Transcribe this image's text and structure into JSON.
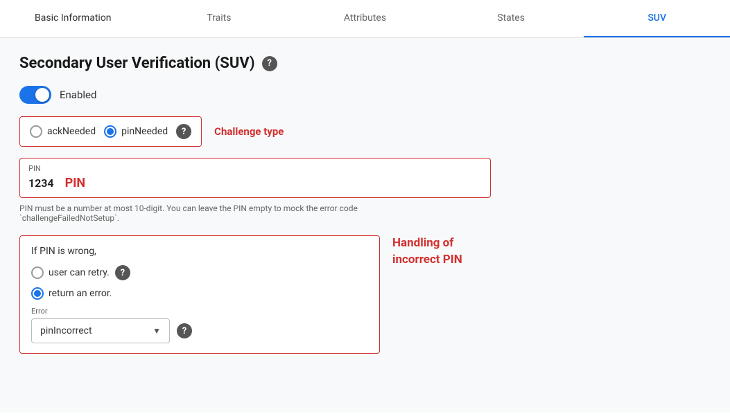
{
  "tabs": [
    {
      "id": "basic-information",
      "label": "Basic Information",
      "active": false
    },
    {
      "id": "traits",
      "label": "Traits",
      "active": false
    },
    {
      "id": "attributes",
      "label": "Attributes",
      "active": false
    },
    {
      "id": "states",
      "label": "States",
      "active": false
    },
    {
      "id": "suv",
      "label": "SUV",
      "active": true
    }
  ],
  "section": {
    "title": "Secondary User Verification (SUV)",
    "help_icon": "?"
  },
  "toggle": {
    "enabled": true,
    "label": "Enabled"
  },
  "challenge_type": {
    "box_label": "Challenge type",
    "options": [
      {
        "id": "ackNeeded",
        "label": "ackNeeded",
        "selected": false
      },
      {
        "id": "pinNeeded",
        "label": "pinNeeded",
        "selected": true
      }
    ],
    "help_icon": "?"
  },
  "pin_field": {
    "field_label": "PIN",
    "value": "1234",
    "inline_label": "PIN",
    "hint": "PIN must be a number at most 10-digit. You can leave the PIN empty to mock the error code `challengeFailedNotSetup`."
  },
  "incorrect_pin": {
    "section_label": "Handling of\nincorrect PIN",
    "title": "If PIN is wrong,",
    "options": [
      {
        "id": "retry",
        "label": "user can retry.",
        "selected": false,
        "has_help": true
      },
      {
        "id": "error",
        "label": "return an error.",
        "selected": true,
        "has_help": false
      }
    ],
    "error_dropdown": {
      "label": "Error",
      "value": "pinIncorrect",
      "help_icon": "?"
    }
  }
}
